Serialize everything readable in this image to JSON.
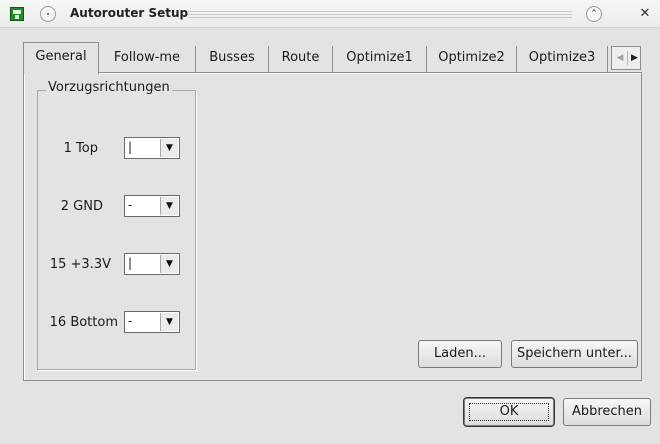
{
  "window": {
    "title": "Autorouter Setup",
    "collapse_glyph": "⌃",
    "close_glyph": "✕"
  },
  "tabs": [
    {
      "label": "General"
    },
    {
      "label": "Follow-me"
    },
    {
      "label": "Busses"
    },
    {
      "label": "Route"
    },
    {
      "label": "Optimize1"
    },
    {
      "label": "Optimize2"
    },
    {
      "label": "Optimize3"
    }
  ],
  "tab_scroll": {
    "left_glyph": "◀",
    "right_glyph": "▶"
  },
  "general": {
    "group_title": "Vorzugsrichtungen",
    "layers": [
      {
        "label": "1 Top",
        "value": "|"
      },
      {
        "label": "2 GND",
        "value": "-"
      },
      {
        "label": "15 +3.3V",
        "value": "|"
      },
      {
        "label": "16 Bottom",
        "value": "-"
      }
    ],
    "load_button": "Laden...",
    "save_as_button": "Speichern unter..."
  },
  "dialog_buttons": {
    "ok": "OK",
    "cancel": "Abbrechen"
  },
  "combo_arrow_glyph": "▼"
}
